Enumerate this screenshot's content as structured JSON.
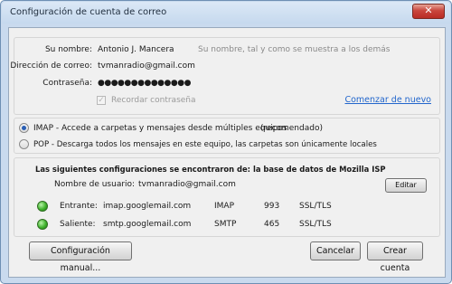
{
  "window": {
    "title": "Configuración de cuenta de correo",
    "close_glyph": "✕"
  },
  "account": {
    "name_label": "Su nombre:",
    "name_value": "Antonio J. Mancera",
    "name_hint": "Su nombre, tal y como se muestra a los demás",
    "email_label": "Dirección de correo:",
    "email_value": "tvmanradio@gmail.com",
    "password_label": "Contraseña:",
    "password_value": "●●●●●●●●●●●●●●",
    "remember_label": "Recordar contraseña",
    "remember_checked": true,
    "restart_link": "Comenzar de nuevo"
  },
  "protocol": {
    "imap_label": "IMAP - Accede a carpetas y mensajes desde múltiples equipos",
    "imap_recommended": "(recomendado)",
    "pop_label": "POP - Descarga todos los mensajes en este equipo, las carpetas son únicamente locales",
    "selected": "IMAP"
  },
  "found": {
    "heading": "Las siguientes configuraciones se encontraron de: la base de datos de Mozilla ISP",
    "username_label": "Nombre de usuario:",
    "username_value": "tvmanradio@gmail.com",
    "edit_button": "Editar",
    "incoming": {
      "label": "Entrante:",
      "host": "imap.googlemail.com",
      "protocol": "IMAP",
      "port": "993",
      "security": "SSL/TLS"
    },
    "outgoing": {
      "label": "Saliente:",
      "host": "smtp.googlemail.com",
      "protocol": "SMTP",
      "port": "465",
      "security": "SSL/TLS"
    },
    "status_color": "#3fb22c"
  },
  "buttons": {
    "manual": "Configuración manual...",
    "cancel": "Cancelar",
    "create": "Crear cuenta"
  }
}
